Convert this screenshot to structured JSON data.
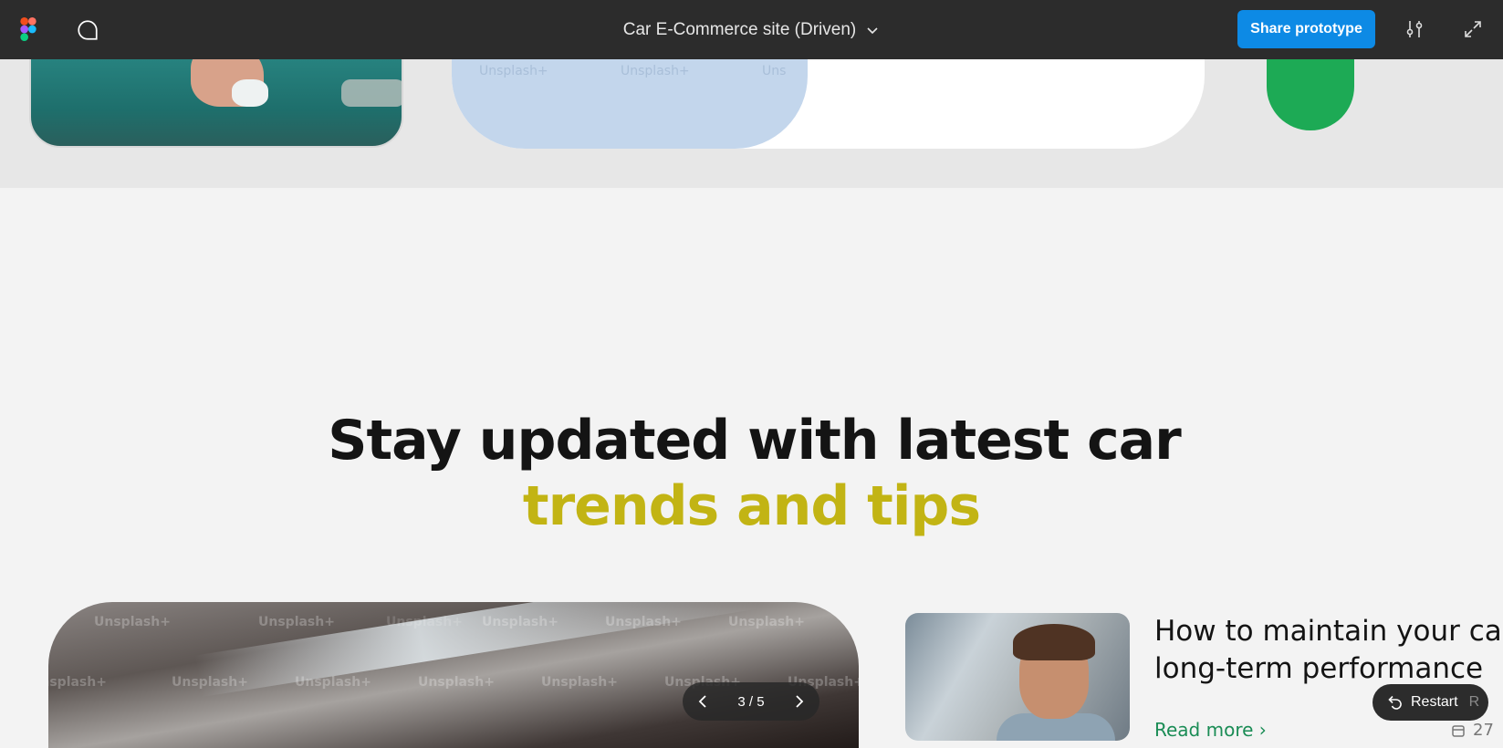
{
  "topbar": {
    "file_title": "Car E-Commerce site (Driven)",
    "share_label": "Share prototype"
  },
  "upper": {
    "watermarks": [
      "Unsplash+",
      "Unsplash+",
      "Uns"
    ]
  },
  "section": {
    "heading_line1": "Stay updated with latest car",
    "heading_line2": "trends and tips",
    "accent_color": "#c2b414"
  },
  "carousel": {
    "counter": "3 / 5"
  },
  "main_image": {
    "watermarks": [
      "Unsplash+",
      "Unsplash+",
      "Unsplash+",
      "Unsplash+",
      "Unsplash+",
      "Unsplash+",
      "Unsplash+",
      "Unsplash+",
      "Unsplash+",
      "Unsplash+",
      "Unsplash+",
      "Unsplash+",
      "Unsplash+"
    ]
  },
  "article": {
    "title": "How to maintain your car long-term performance",
    "read_more": "Read more",
    "date_prefix": "27"
  },
  "restart": {
    "label": "Restart",
    "shortcut": "R"
  },
  "colors": {
    "figma_bar": "#2c2c2c",
    "share_blue": "#0d8ae5",
    "read_more_green": "#1a8c55",
    "green_circle": "#1daa55"
  }
}
